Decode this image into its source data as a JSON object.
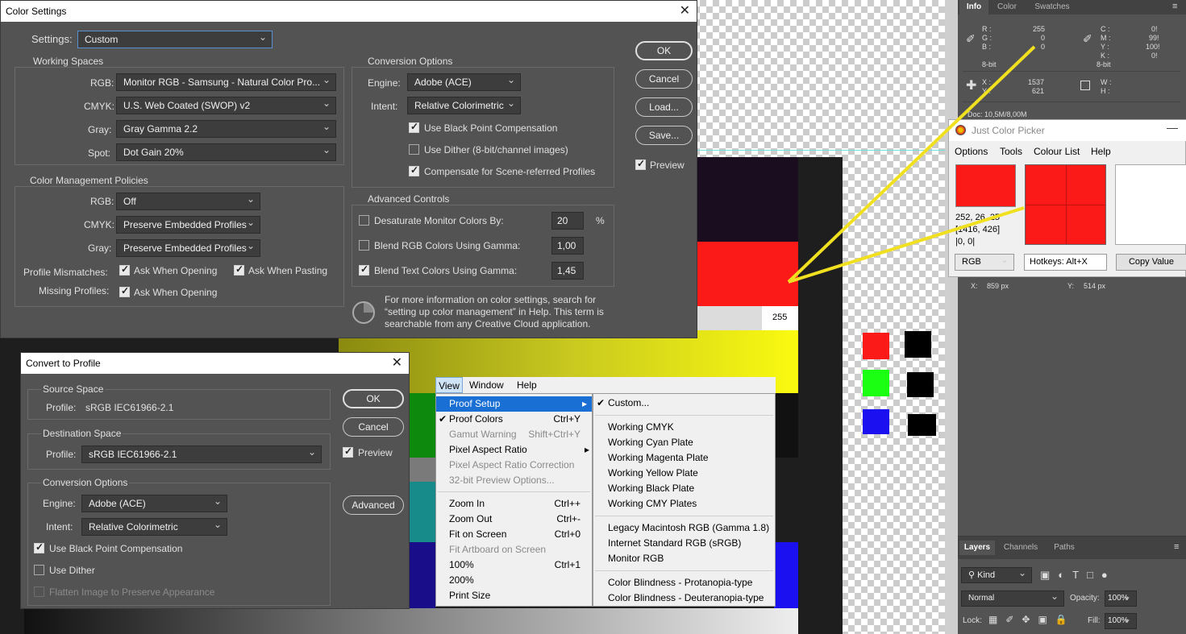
{
  "colors": {
    "accent": "#1a6fd4",
    "picked_red": "#fc1a19",
    "arrow": "#f0e020"
  },
  "color_settings": {
    "title": "Color Settings",
    "settings_label": "Settings:",
    "settings_value": "Custom",
    "working_spaces_title": "Working Spaces",
    "rgb_label": "RGB:",
    "rgb_value": "Monitor RGB - Samsung - Natural Color Pro...",
    "cmyk_label": "CMYK:",
    "cmyk_value": "U.S. Web Coated (SWOP) v2",
    "gray_label": "Gray:",
    "gray_value": "Gray Gamma 2.2",
    "spot_label": "Spot:",
    "spot_value": "Dot Gain 20%",
    "policies_title": "Color Management Policies",
    "pol_rgb_label": "RGB:",
    "pol_rgb_value": "Off",
    "pol_cmyk_label": "CMYK:",
    "pol_cmyk_value": "Preserve Embedded Profiles",
    "pol_gray_label": "Gray:",
    "pol_gray_value": "Preserve Embedded Profiles",
    "mismatch_label": "Profile Mismatches:",
    "ask_opening": "Ask When Opening",
    "ask_pasting": "Ask When Pasting",
    "missing_label": "Missing Profiles:",
    "missing_ask_opening": "Ask When Opening",
    "conversion_title": "Conversion Options",
    "engine_label": "Engine:",
    "engine_value": "Adobe (ACE)",
    "intent_label": "Intent:",
    "intent_value": "Relative Colorimetric",
    "bpc": "Use Black Point Compensation",
    "dither": "Use Dither (8-bit/channel images)",
    "scene": "Compensate for Scene-referred Profiles",
    "advanced_title": "Advanced Controls",
    "desaturate": "Desaturate Monitor Colors By:",
    "desaturate_value": "20",
    "percent": "%",
    "blend_rgb": "Blend RGB Colors Using Gamma:",
    "blend_rgb_value": "1,00",
    "blend_text": "Blend Text Colors Using Gamma:",
    "blend_text_value": "1,45",
    "info_text_1": "For more information on color settings, search for",
    "info_text_2": "“setting up color management” in Help. This term is",
    "info_text_3": "searchable from any Creative Cloud application.",
    "ok": "OK",
    "cancel": "Cancel",
    "load": "Load...",
    "save": "Save...",
    "preview": "Preview"
  },
  "convert": {
    "title": "Convert to Profile",
    "source_title": "Source Space",
    "profile_label": "Profile:",
    "source_profile": "sRGB IEC61966-2.1",
    "dest_title": "Destination Space",
    "dest_profile_label": "Profile:",
    "dest_profile": "sRGB IEC61966-2.1",
    "conv_title": "Conversion Options",
    "engine_label": "Engine:",
    "engine_value": "Adobe (ACE)",
    "intent_label": "Intent:",
    "intent_value": "Relative Colorimetric",
    "bpc": "Use Black Point Compensation",
    "dither": "Use Dither",
    "flatten": "Flatten Image to Preserve Appearance",
    "ok": "OK",
    "cancel": "Cancel",
    "preview": "Preview",
    "advanced": "Advanced"
  },
  "menubar": {
    "view": "View",
    "window": "Window",
    "help": "Help"
  },
  "view_menu": [
    {
      "label": "Proof Setup",
      "shortcut": "",
      "state": "highlight"
    },
    {
      "label": "Proof Colors",
      "shortcut": "Ctrl+Y",
      "state": "checked"
    },
    {
      "label": "Gamut Warning",
      "shortcut": "Shift+Ctrl+Y",
      "state": "disabled"
    },
    {
      "label": "Pixel Aspect Ratio",
      "shortcut": "",
      "state": "submenu"
    },
    {
      "label": "Pixel Aspect Ratio Correction",
      "shortcut": "",
      "state": "disabled"
    },
    {
      "label": "32-bit Preview Options...",
      "shortcut": "",
      "state": "disabled"
    },
    {
      "label": "Zoom In",
      "shortcut": "Ctrl++",
      "state": ""
    },
    {
      "label": "Zoom Out",
      "shortcut": "Ctrl+-",
      "state": ""
    },
    {
      "label": "Fit on Screen",
      "shortcut": "Ctrl+0",
      "state": ""
    },
    {
      "label": "Fit Artboard on Screen",
      "shortcut": "",
      "state": "disabled"
    },
    {
      "label": "100%",
      "shortcut": "Ctrl+1",
      "state": ""
    },
    {
      "label": "200%",
      "shortcut": "",
      "state": ""
    },
    {
      "label": "Print Size",
      "shortcut": "",
      "state": ""
    }
  ],
  "proof_submenu": [
    "Custom...",
    "Working CMYK",
    "Working Cyan Plate",
    "Working Magenta Plate",
    "Working Yellow Plate",
    "Working Black Plate",
    "Working CMY Plates",
    "Legacy Macintosh RGB (Gamma 1.8)",
    "Internet Standard RGB (sRGB)",
    "Monitor RGB",
    "Color Blindness - Protanopia-type",
    "Color Blindness - Deuteranopia-type"
  ],
  "canvas": {
    "value_255": "255"
  },
  "info_panel": {
    "tabs": [
      "Info",
      "Color",
      "Swatches"
    ],
    "r": "R :",
    "g": "G :",
    "b": "B :",
    "r_val": "255",
    "g_val": "0",
    "b_val": "0",
    "c": "C :",
    "m": "M :",
    "y": "Y :",
    "k": "K :",
    "c_val": "0!",
    "m_val": "99!",
    "y_val": "100!",
    "k_val": "0!",
    "bit_left": "8-bit",
    "bit_right": "8-bit",
    "x": "X :",
    "y_lbl": "Y :",
    "x_val": "1537",
    "y_val2": "621",
    "w": "W :",
    "h": "H :",
    "doc": "Doc: 10,5M/8,00M",
    "x_px_label": "X:",
    "x_px": "859 px",
    "y_px_label": "Y:",
    "y_px": "514 px"
  },
  "jcp": {
    "title": "Just Color Picker",
    "menu": [
      "Options",
      "Tools",
      "Colour List",
      "Help"
    ],
    "rgb_text": "252, 26, 25",
    "coords": "[1416, 426]",
    "offset": "|0, 0|",
    "format": "RGB",
    "hotkeys": "Hotkeys: Alt+X",
    "copy": "Copy Value"
  },
  "layers": {
    "tabs": [
      "Layers",
      "Channels",
      "Paths"
    ],
    "kind": "Kind",
    "blend": "Normal",
    "opacity_label": "Opacity:",
    "opacity": "100%",
    "lock_label": "Lock:",
    "fill_label": "Fill:",
    "fill": "100%"
  }
}
